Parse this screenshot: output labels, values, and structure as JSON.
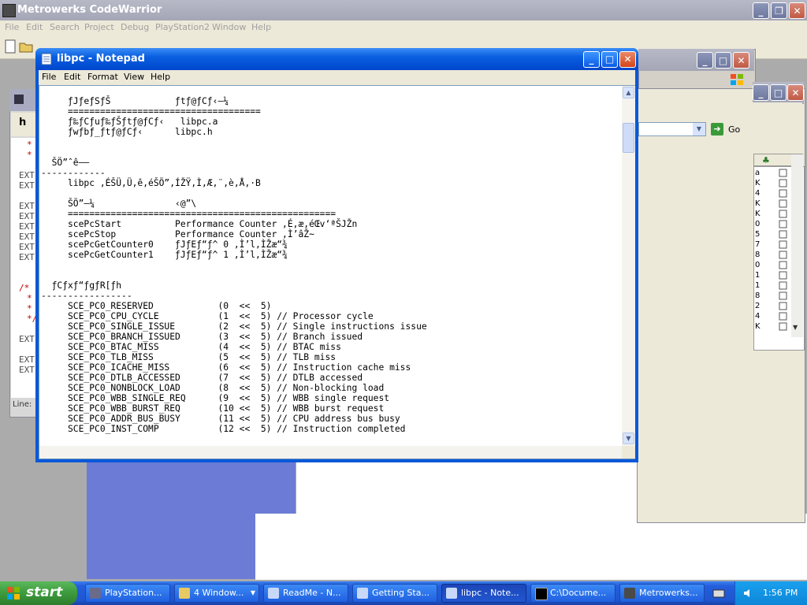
{
  "codewarrior": {
    "title": "Metrowerks CodeWarrior",
    "menu": [
      "File",
      "Edit",
      "Search",
      "Project",
      "Debug",
      "PlayStation2",
      "Window",
      "Help"
    ],
    "editor": {
      "status_label": "Line:",
      "lines": [
        "*",
        "*",
        "EXT",
        "EXT",
        "EXT",
        "EXT",
        "EXT",
        "EXT",
        "EXT",
        "EXT",
        "/*",
        "*",
        "*",
        "*/",
        "EXT",
        "EXT",
        "EXT"
      ]
    },
    "address_go": "Go",
    "list_col": [
      "a",
      "K",
      "4",
      "K",
      "K",
      "0",
      "5",
      "7",
      "8",
      "0",
      "1",
      "1",
      "8",
      "2",
      "4",
      "K"
    ]
  },
  "notepad": {
    "title": "libpc - Notepad",
    "menu": [
      "File",
      "Edit",
      "Format",
      "View",
      "Help"
    ],
    "content": "     ƒJƒeƒSƒŠ            ƒtƒ@ƒCƒ‹–¼\n     ====================================\n     ƒ‰ƒCƒuƒ‰ƒŠƒtƒ@ƒCƒ‹   libpc.a\n     ƒwƒbƒ_ƒtƒ@ƒCƒ‹      libpc.h\n\n\n  ŠÖ”ˆê——\n------------\n     libpc ‚ÉŠÜ‚Ü‚ê‚éŠÖ”‚ÍŽŸ‚Ì‚Æ‚¨‚è‚Å‚·B\n\n     ŠÖ”–¼               ‹@”\\\n     ==================================================\n     scePcStart          Performance Counter ‚É‚æ‚éŒv‘ªŠJŽn\n     scePcStop           Performance Counter ‚Ì’âŽ~\n     scePcGetCounter0    ƒJƒEƒ“ƒ^ 0 ‚Ì’l‚ÌŽæ“¾\n     scePcGetCounter1    ƒJƒEƒ“ƒ^ 1 ‚Ì’l‚ÌŽæ“¾\n\n\n  ƒCƒxƒ“ƒgƒR[ƒh\n-----------------\n     SCE_PC0_RESERVED            (0  <<  5)\n     SCE_PC0_CPU_CYCLE           (1  <<  5) // Processor cycle\n     SCE_PC0_SINGLE_ISSUE        (2  <<  5) // Single instructions issue\n     SCE_PC0_BRANCH_ISSUED       (3  <<  5) // Branch issued\n     SCE_PC0_BTAC_MISS           (4  <<  5) // BTAC miss\n     SCE_PC0_TLB_MISS            (5  <<  5) // TLB miss\n     SCE_PC0_ICACHE_MISS         (6  <<  5) // Instruction cache miss\n     SCE_PC0_DTLB_ACCESSED       (7  <<  5) // DTLB accessed\n     SCE_PC0_NONBLOCK_LOAD       (8  <<  5) // Non-blocking load\n     SCE_PC0_WBB_SINGLE_REQ      (9  <<  5) // WBB single request\n     SCE_PC0_WBB_BURST_REQ       (10 <<  5) // WBB burst request\n     SCE_PC0_ADDR_BUS_BUSY       (11 <<  5) // CPU address bus busy\n     SCE_PC0_INST_COMP           (12 <<  5) // Instruction completed"
  },
  "taskbar": {
    "start": "start",
    "tasks": [
      "PlayStation...",
      "4 Window...",
      "ReadMe - N...",
      "Getting Sta...",
      "libpc - Note...",
      "C:\\Docume...",
      "Metrowerks..."
    ],
    "clock": "1:56 PM"
  },
  "colors": {
    "xp_blue": "#0a58d8",
    "taskbar_blue": "#245edb",
    "start_green": "#3c9a3c",
    "inactive_title": "#a4a6b6"
  }
}
